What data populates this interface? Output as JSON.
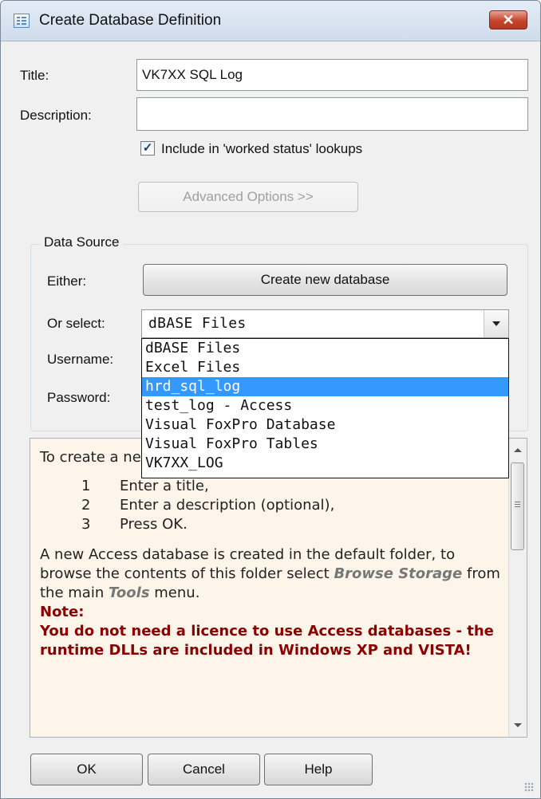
{
  "window": {
    "title": "Create Database Definition",
    "close_label": "✕"
  },
  "form": {
    "title_label": "Title:",
    "title_value": "VK7XX SQL Log",
    "description_label": "Description:",
    "description_value": "",
    "checkbox_label": "Include in 'worked status' lookups",
    "checkbox_checked": true,
    "checkbox_mark": "✓",
    "advanced_button": "Advanced Options >>"
  },
  "data_source": {
    "group_title": "Data Source",
    "either_label": "Either:",
    "create_button": "Create new database",
    "or_select_label": "Or select:",
    "selected_value": "dBASE Files",
    "username_label": "Username:",
    "password_label": "Password:",
    "dropdown_items": [
      "dBASE Files",
      "Excel Files",
      "hrd_sql_log",
      "test_log - Access",
      "Visual FoxPro Database",
      "Visual FoxPro Tables",
      "VK7XX_LOG"
    ],
    "highlighted_index": 2
  },
  "help": {
    "intro": "To create a new Access database:",
    "steps": [
      {
        "num": "1",
        "text": "Enter a title,"
      },
      {
        "num": "2",
        "text": "Enter a description (optional),"
      },
      {
        "num": "3",
        "text": "Press OK."
      }
    ],
    "para_start": "A new Access database is created in the default folder, to browse the contents of this folder select ",
    "browse_kw": "Browse Storage",
    "para_mid": " from the main ",
    "tools_kw": "Tools",
    "para_end": " menu.",
    "note_title": "Note:",
    "note_body": "You do not need a licence to use Access databases - the runtime DLLs are included in Windows XP and VISTA!"
  },
  "buttons": {
    "ok": "OK",
    "cancel": "Cancel",
    "help": "Help"
  },
  "colors": {
    "selection": "#3399ff",
    "note_text": "#8b0000",
    "close_button": "#c6432b",
    "help_background": "#fdf5ea"
  }
}
